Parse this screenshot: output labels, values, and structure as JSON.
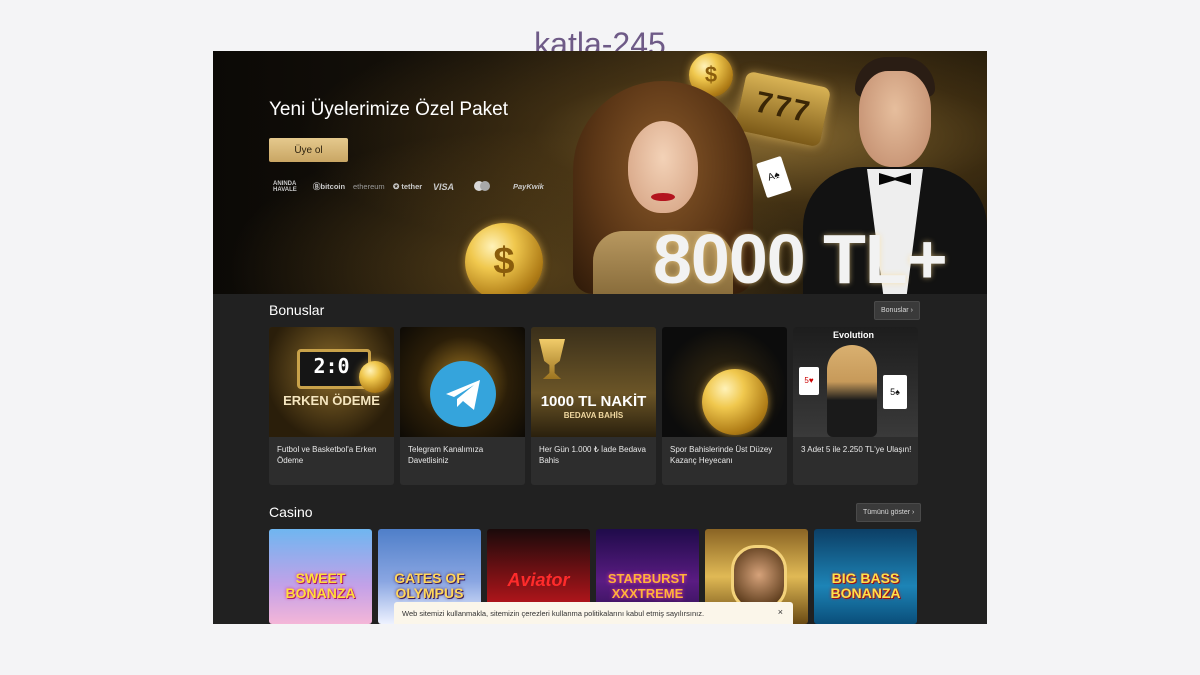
{
  "page_heading": "katla-245",
  "hero": {
    "title": "Yeni Üyelerimize Özel Paket",
    "signup_label": "Üye ol",
    "promo_text": "8000 TL+",
    "payments": [
      {
        "name": "aninda-havale",
        "label_line1": "ANINDA",
        "label_line2": "HAVALE"
      },
      {
        "name": "bitcoin",
        "label": "Ⓑbitcoin"
      },
      {
        "name": "ethereum",
        "label": "ethereum"
      },
      {
        "name": "tether",
        "label": "✪ tether"
      },
      {
        "name": "visa",
        "label": "VISA"
      },
      {
        "name": "mastercard",
        "label": ""
      },
      {
        "name": "paykwik",
        "label": "PayKwik"
      }
    ],
    "slot_symbols": "777"
  },
  "bonuses": {
    "title": "Bonuslar",
    "more_label": "Bonuslar ›",
    "items": [
      {
        "image_text": "ERKEN ÖDEME",
        "score": "2:0",
        "text": "Futbol ve Basketbol'a Erken Ödeme"
      },
      {
        "image_text": "",
        "text": "Telegram Kanalımıza Davetlisiniz"
      },
      {
        "image_text": "1000 TL NAKİT",
        "image_sub": "BEDAVA BAHİS",
        "text": "Her Gün 1.000 ₺ İade Bedava Bahis"
      },
      {
        "image_text": "",
        "text": "Spor Bahislerinde Üst Düzey Kazanç Heyecanı"
      },
      {
        "image_text": "Evolution",
        "text": "3 Adet 5 ile 2.250 TL'ye Ulaşın!"
      }
    ]
  },
  "casino": {
    "title": "Casino",
    "more_label": "Tümünü göster ›",
    "games": [
      {
        "title": "SWEET BONANZA"
      },
      {
        "title": "GATES OF OLYMPUS"
      },
      {
        "title": "Aviator"
      },
      {
        "title": "STARBURST XXXTREME"
      },
      {
        "title": ""
      },
      {
        "title": "BIG BASS BONANZA"
      }
    ]
  },
  "cookie": {
    "text": "Web sitemizi kullanmakla, sitemizin çerezleri kullanma politikalarını kabul etmiş sayılırsınız.",
    "close": "×"
  }
}
